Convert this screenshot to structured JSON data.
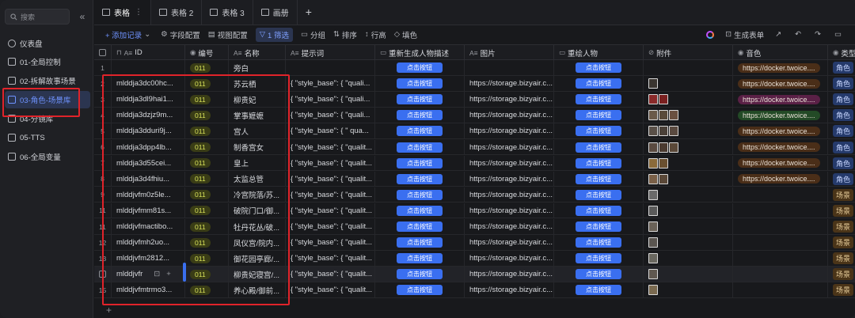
{
  "sidebar": {
    "search_placeholder": "搜索",
    "collapse_glyph": "«",
    "items": [
      {
        "label": "仪表盘",
        "icon": "dashboard-icon"
      },
      {
        "label": "01-全局控制",
        "icon": "table-icon"
      },
      {
        "label": "02-拆解故事场景",
        "icon": "table-icon"
      },
      {
        "label": "03-角色-场景库",
        "icon": "table-icon",
        "active": true
      },
      {
        "label": "04-分镜库",
        "icon": "table-icon"
      },
      {
        "label": "05-TTS",
        "icon": "table-icon"
      },
      {
        "label": "06-全局变量",
        "icon": "table-icon"
      }
    ]
  },
  "tabs": [
    {
      "label": "表格",
      "active": true
    },
    {
      "label": "表格 2"
    },
    {
      "label": "表格 3"
    },
    {
      "label": "画册"
    }
  ],
  "toolbar": {
    "add_record": "+ 添加记录",
    "field_config": "字段配置",
    "view_config": "视图配置",
    "filter": "1 筛选",
    "group": "分组",
    "sort": "排序",
    "row_height": "行高",
    "fill_color": "填色",
    "generate_form": "生成表单"
  },
  "columns": [
    "ID",
    "编号",
    "名称",
    "提示词",
    "重新生成人物描述",
    "图片",
    "重绘人物",
    "附件",
    "音色",
    "类型"
  ],
  "button_label": "点击按钮",
  "rows": [
    {
      "n": "1",
      "id": "",
      "code": "011",
      "name": "旁白",
      "prompt": "",
      "image": "",
      "thumbs": [],
      "voice": "https://docker.twoice....",
      "voice_color": "brown",
      "type": "角色",
      "type_kind": "role",
      "btn": true
    },
    {
      "n": "2",
      "id": "mlddja3dc00hc...",
      "code": "011",
      "name": "苏云栖",
      "prompt": "{ \"style_base\": { \"quali...",
      "image": "https://storage.bizyair.c...",
      "thumbs": [
        "#3a3530"
      ],
      "voice": "https://docker.twoice....",
      "voice_color": "brown",
      "type": "角色",
      "type_kind": "role",
      "btn": true
    },
    {
      "n": "3",
      "id": "mlddja3dl9hai1...",
      "code": "011",
      "name": "柳贵妃",
      "prompt": "{ \"style_base\": { \"quali...",
      "image": "https://storage.bizyair.c...",
      "thumbs": [
        "#8a2a2a",
        "#7a2020"
      ],
      "voice": "https://docker.twoice....",
      "voice_color": "pink",
      "type": "角色",
      "type_kind": "role",
      "btn": true
    },
    {
      "n": "4",
      "id": "mlddja3dzjz9m...",
      "code": "011",
      "name": "掌事嬷嬷",
      "prompt": "{ \"style_base\": { \"quali...",
      "image": "https://storage.bizyair.c...",
      "thumbs": [
        "#6a5a4a",
        "#5a4a3a",
        "#6a5040"
      ],
      "voice": "https://docker.twoice....",
      "voice_color": "green",
      "type": "角色",
      "type_kind": "role",
      "btn": true
    },
    {
      "n": "5",
      "id": "mlddja3dduri9j...",
      "code": "011",
      "name": "宫人",
      "prompt": "{ \"style_base\": { \"  qua...",
      "image": "https://storage.bizyair.c...",
      "thumbs": [
        "#5a5048",
        "#4a4038",
        "#5a4a40"
      ],
      "voice": "https://docker.twoice....",
      "voice_color": "brown",
      "type": "角色",
      "type_kind": "role",
      "btn": true
    },
    {
      "n": "6",
      "id": "mlddja3dpp4lb...",
      "code": "011",
      "name": "制香宫女",
      "prompt": "{ \"style_base\": { \"qualit...",
      "image": "https://storage.bizyair.c...",
      "thumbs": [
        "#5a4a40",
        "#4a3a30",
        "#5a4838"
      ],
      "voice": "https://docker.twoice....",
      "voice_color": "brown",
      "type": "角色",
      "type_kind": "role",
      "btn": true
    },
    {
      "n": "7",
      "id": "mlddja3d55cei...",
      "code": "011",
      "name": "皇上",
      "prompt": "{ \"style_base\": { \"qualit...",
      "image": "https://storage.bizyair.c...",
      "thumbs": [
        "#8a6a3a",
        "#6a5030"
      ],
      "voice": "https://docker.twoice....",
      "voice_color": "brown",
      "type": "角色",
      "type_kind": "role",
      "btn": true
    },
    {
      "n": "8",
      "id": "mlddja3d4fhiu...",
      "code": "011",
      "name": "太监总管",
      "prompt": "{ \"style_base\": { \"qualit...",
      "image": "https://storage.bizyair.c...",
      "thumbs": [
        "#7a6048",
        "#5a4838"
      ],
      "voice": "https://docker.twoice....",
      "voice_color": "brown",
      "type": "角色",
      "type_kind": "role",
      "btn": true
    },
    {
      "n": "9",
      "id": "mlddjvfm0z5le...",
      "code": "011",
      "name": "冷宫院落/苏...",
      "prompt": "{ \"style_base\": { \"qualit...",
      "image": "https://storage.bizyair.c...",
      "thumbs": [
        "#6a6a6a"
      ],
      "voice": "",
      "voice_color": "",
      "type": "场景",
      "type_kind": "scene",
      "btn": true
    },
    {
      "n": "11",
      "id": "mlddjvfmm81s...",
      "code": "011",
      "name": "破院门口/御...",
      "prompt": "{ \"style_base\": { \"qualit...",
      "image": "https://storage.bizyair.c...",
      "thumbs": [
        "#5a5a5a"
      ],
      "voice": "",
      "voice_color": "",
      "type": "场景",
      "type_kind": "scene",
      "btn": true
    },
    {
      "n": "11",
      "id": "mlddjvfmactibo...",
      "code": "011",
      "name": "牡丹花丛/破...",
      "prompt": "{ \"style_base\": { \"qualit...",
      "image": "https://storage.bizyair.c...",
      "thumbs": [
        "#6a6258"
      ],
      "voice": "",
      "voice_color": "",
      "type": "场景",
      "type_kind": "scene",
      "btn": true
    },
    {
      "n": "12",
      "id": "mlddjvfmh2uo...",
      "code": "011",
      "name": "凤仪宫/院内...",
      "prompt": "{ \"style_base\": { \"qualit...",
      "image": "https://storage.bizyair.c...",
      "thumbs": [
        "#5a5550"
      ],
      "voice": "",
      "voice_color": "",
      "type": "场景",
      "type_kind": "scene",
      "btn": true
    },
    {
      "n": "13",
      "id": "mlddjvfm2812...",
      "code": "011",
      "name": "御花园亭廊/...",
      "prompt": "{ \"style_base\": { \"qualit...",
      "image": "https://storage.bizyair.c...",
      "thumbs": [
        "#6a6860"
      ],
      "voice": "",
      "voice_color": "",
      "type": "场景",
      "type_kind": "scene",
      "btn": true
    },
    {
      "n": "",
      "id": "mlddjvfr",
      "code": "011",
      "name": "柳贵妃寝宫/...",
      "prompt": "{ \"style_base\": { \"qualit...",
      "image": "https://storage.bizyair.c...",
      "thumbs": [
        "#605850"
      ],
      "voice": "",
      "voice_color": "",
      "type": "场景",
      "type_kind": "scene",
      "btn": true,
      "hover": true
    },
    {
      "n": "15",
      "id": "mlddjvfmtrmo3...",
      "code": "011",
      "name": "养心殿/御前...",
      "prompt": "{ \"style_base\": { \"qualit...",
      "image": "https://storage.bizyair.c...",
      "thumbs": [
        "#7a6a50"
      ],
      "voice": "",
      "voice_color": "",
      "type": "场景",
      "type_kind": "scene",
      "btn": true
    }
  ]
}
